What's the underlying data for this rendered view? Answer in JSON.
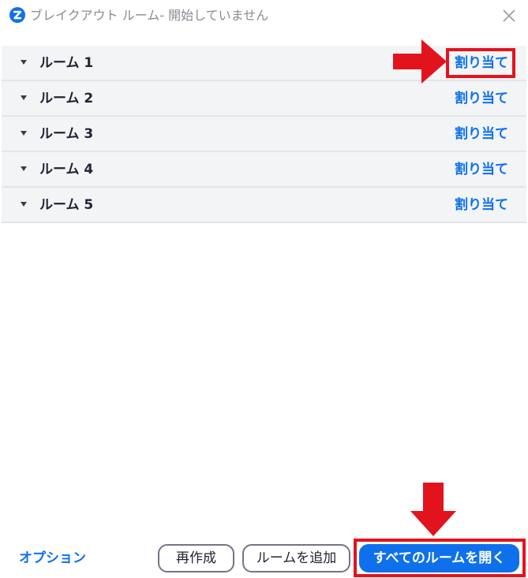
{
  "window": {
    "title": "ブレイクアウト ルーム- 開始していません",
    "logo_icon": "zoom-logo-icon",
    "close_icon": "close-icon"
  },
  "rooms": [
    {
      "name": "ルーム 1",
      "assign_label": "割り当て"
    },
    {
      "name": "ルーム 2",
      "assign_label": "割り当て"
    },
    {
      "name": "ルーム 3",
      "assign_label": "割り当て"
    },
    {
      "name": "ルーム 4",
      "assign_label": "割り当て"
    },
    {
      "name": "ルーム 5",
      "assign_label": "割り当て"
    }
  ],
  "footer": {
    "options_label": "オプション",
    "recreate_label": "再作成",
    "add_room_label": "ルームを追加",
    "open_all_label": "すべてのルームを開く"
  },
  "colors": {
    "accent": "#0e71eb",
    "annotation_red": "#e3131d",
    "row_background": "#f3f4f6"
  }
}
